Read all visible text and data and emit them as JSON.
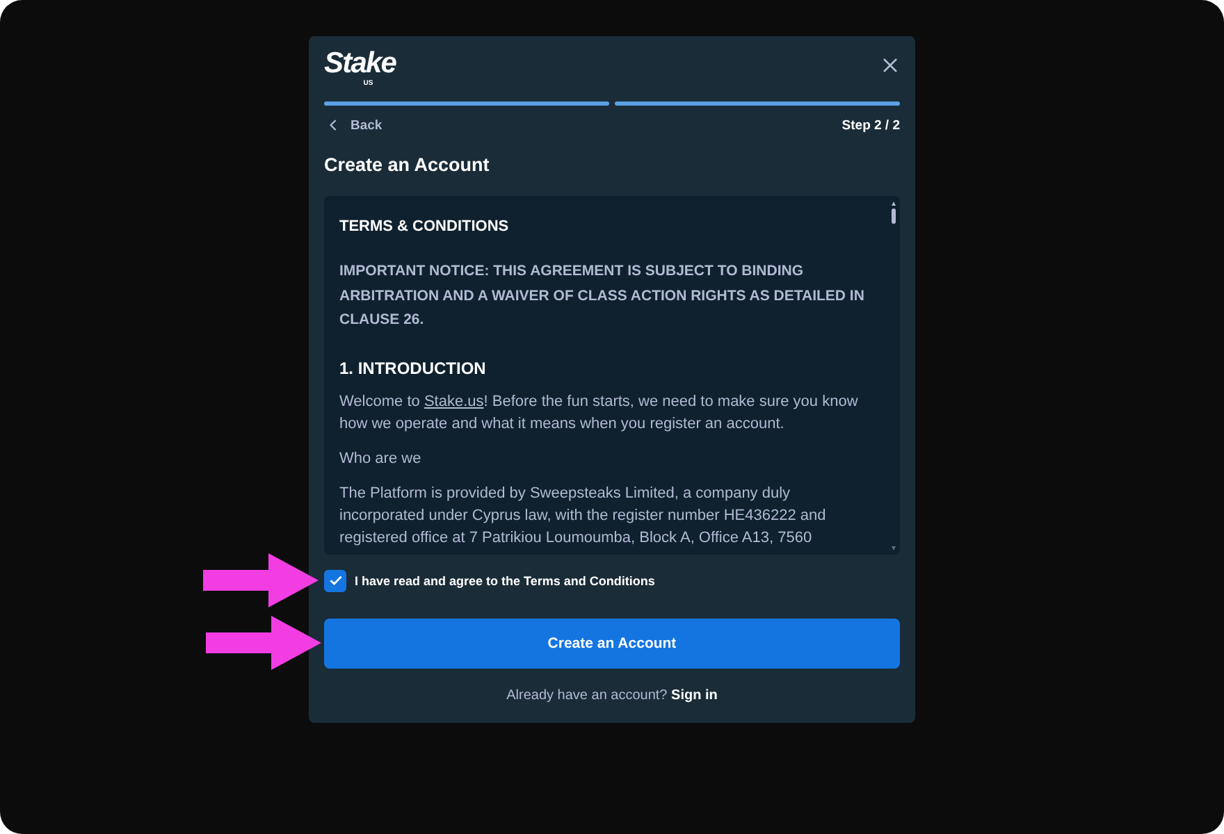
{
  "logo": {
    "wordmark": "Stake",
    "suffix": "US"
  },
  "progress": [
    {
      "complete": true
    },
    {
      "complete": true
    }
  ],
  "nav": {
    "back": "Back",
    "step": "Step 2 / 2"
  },
  "title": "Create an Account",
  "terms": {
    "blocks": [
      {
        "kind": "title",
        "text": "TERMS & CONDITIONS"
      },
      {
        "kind": "notice",
        "text": "IMPORTANT NOTICE: THIS AGREEMENT IS SUBJECT TO BINDING ARBITRATION AND A WAIVER OF CLASS ACTION RIGHTS AS DETAILED IN CLAUSE 26."
      },
      {
        "kind": "heading",
        "text": "1. INTRODUCTION"
      },
      {
        "kind": "linked_paragraph",
        "before": "Welcome to ",
        "link": "Stake.us",
        "after": "! Before the fun starts, we need to make sure you know how we operate and what it means when you register an account."
      },
      {
        "kind": "paragraph",
        "text": "Who are we"
      },
      {
        "kind": "paragraph",
        "text": "The Platform is provided by Sweepsteaks Limited, a company duly incorporated under Cyprus law, with the register number HE436222 and registered office at 7 Patrikiou Loumoumba, Block A, Office A13, 7560"
      }
    ]
  },
  "agreement": {
    "label": "I have read and agree to the Terms and Conditions",
    "checked": true
  },
  "submit": "Create an Account",
  "footer": {
    "text": "Already have an account?",
    "link": "Sign in"
  }
}
